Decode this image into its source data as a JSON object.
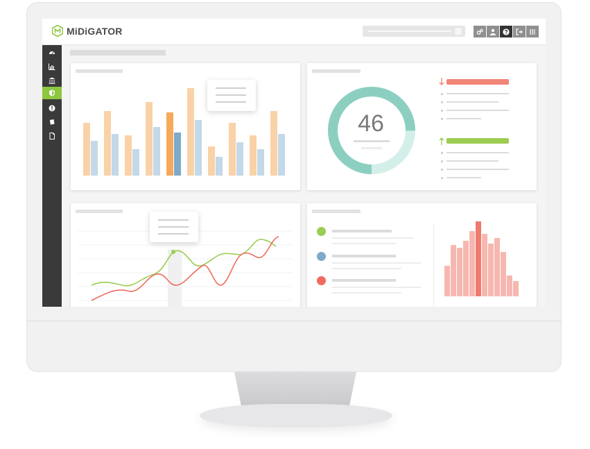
{
  "app": {
    "brand": "MiDiGATOR",
    "brand_color": "#8dc63f"
  },
  "toolbar": {
    "icons": [
      "settings-icon",
      "user-icon",
      "help-icon",
      "logout-icon",
      "menu-icon"
    ]
  },
  "sidebar": {
    "items": [
      {
        "icon": "dashboard-icon",
        "active": false
      },
      {
        "icon": "chart-icon",
        "active": false
      },
      {
        "icon": "bank-icon",
        "active": false
      },
      {
        "icon": "shield-icon",
        "active": true
      },
      {
        "icon": "alert-icon",
        "active": false
      },
      {
        "icon": "book-icon",
        "active": false
      },
      {
        "icon": "document-icon",
        "active": false
      }
    ]
  },
  "widgets": {
    "donut": {
      "value": "46",
      "fraction": 0.75,
      "ring_color": "#8ccfc1",
      "ring_light": "#d4efea"
    },
    "trend_down_color": "#f08578",
    "trend_up_color": "#9ccc52"
  },
  "colors": {
    "orange": "#f9d2a8",
    "orange_strong": "#f7a95a",
    "blue": "#c3d8e8",
    "blue_strong": "#7fa9c9",
    "green_line": "#9ccc52",
    "red_line": "#ef6b5e",
    "salmon": "#f6b7b0",
    "salmon_strong": "#ee7a70",
    "legend_green": "#9ccc52",
    "legend_blue": "#7fa9c9",
    "legend_red": "#ef6b5e"
  }
}
